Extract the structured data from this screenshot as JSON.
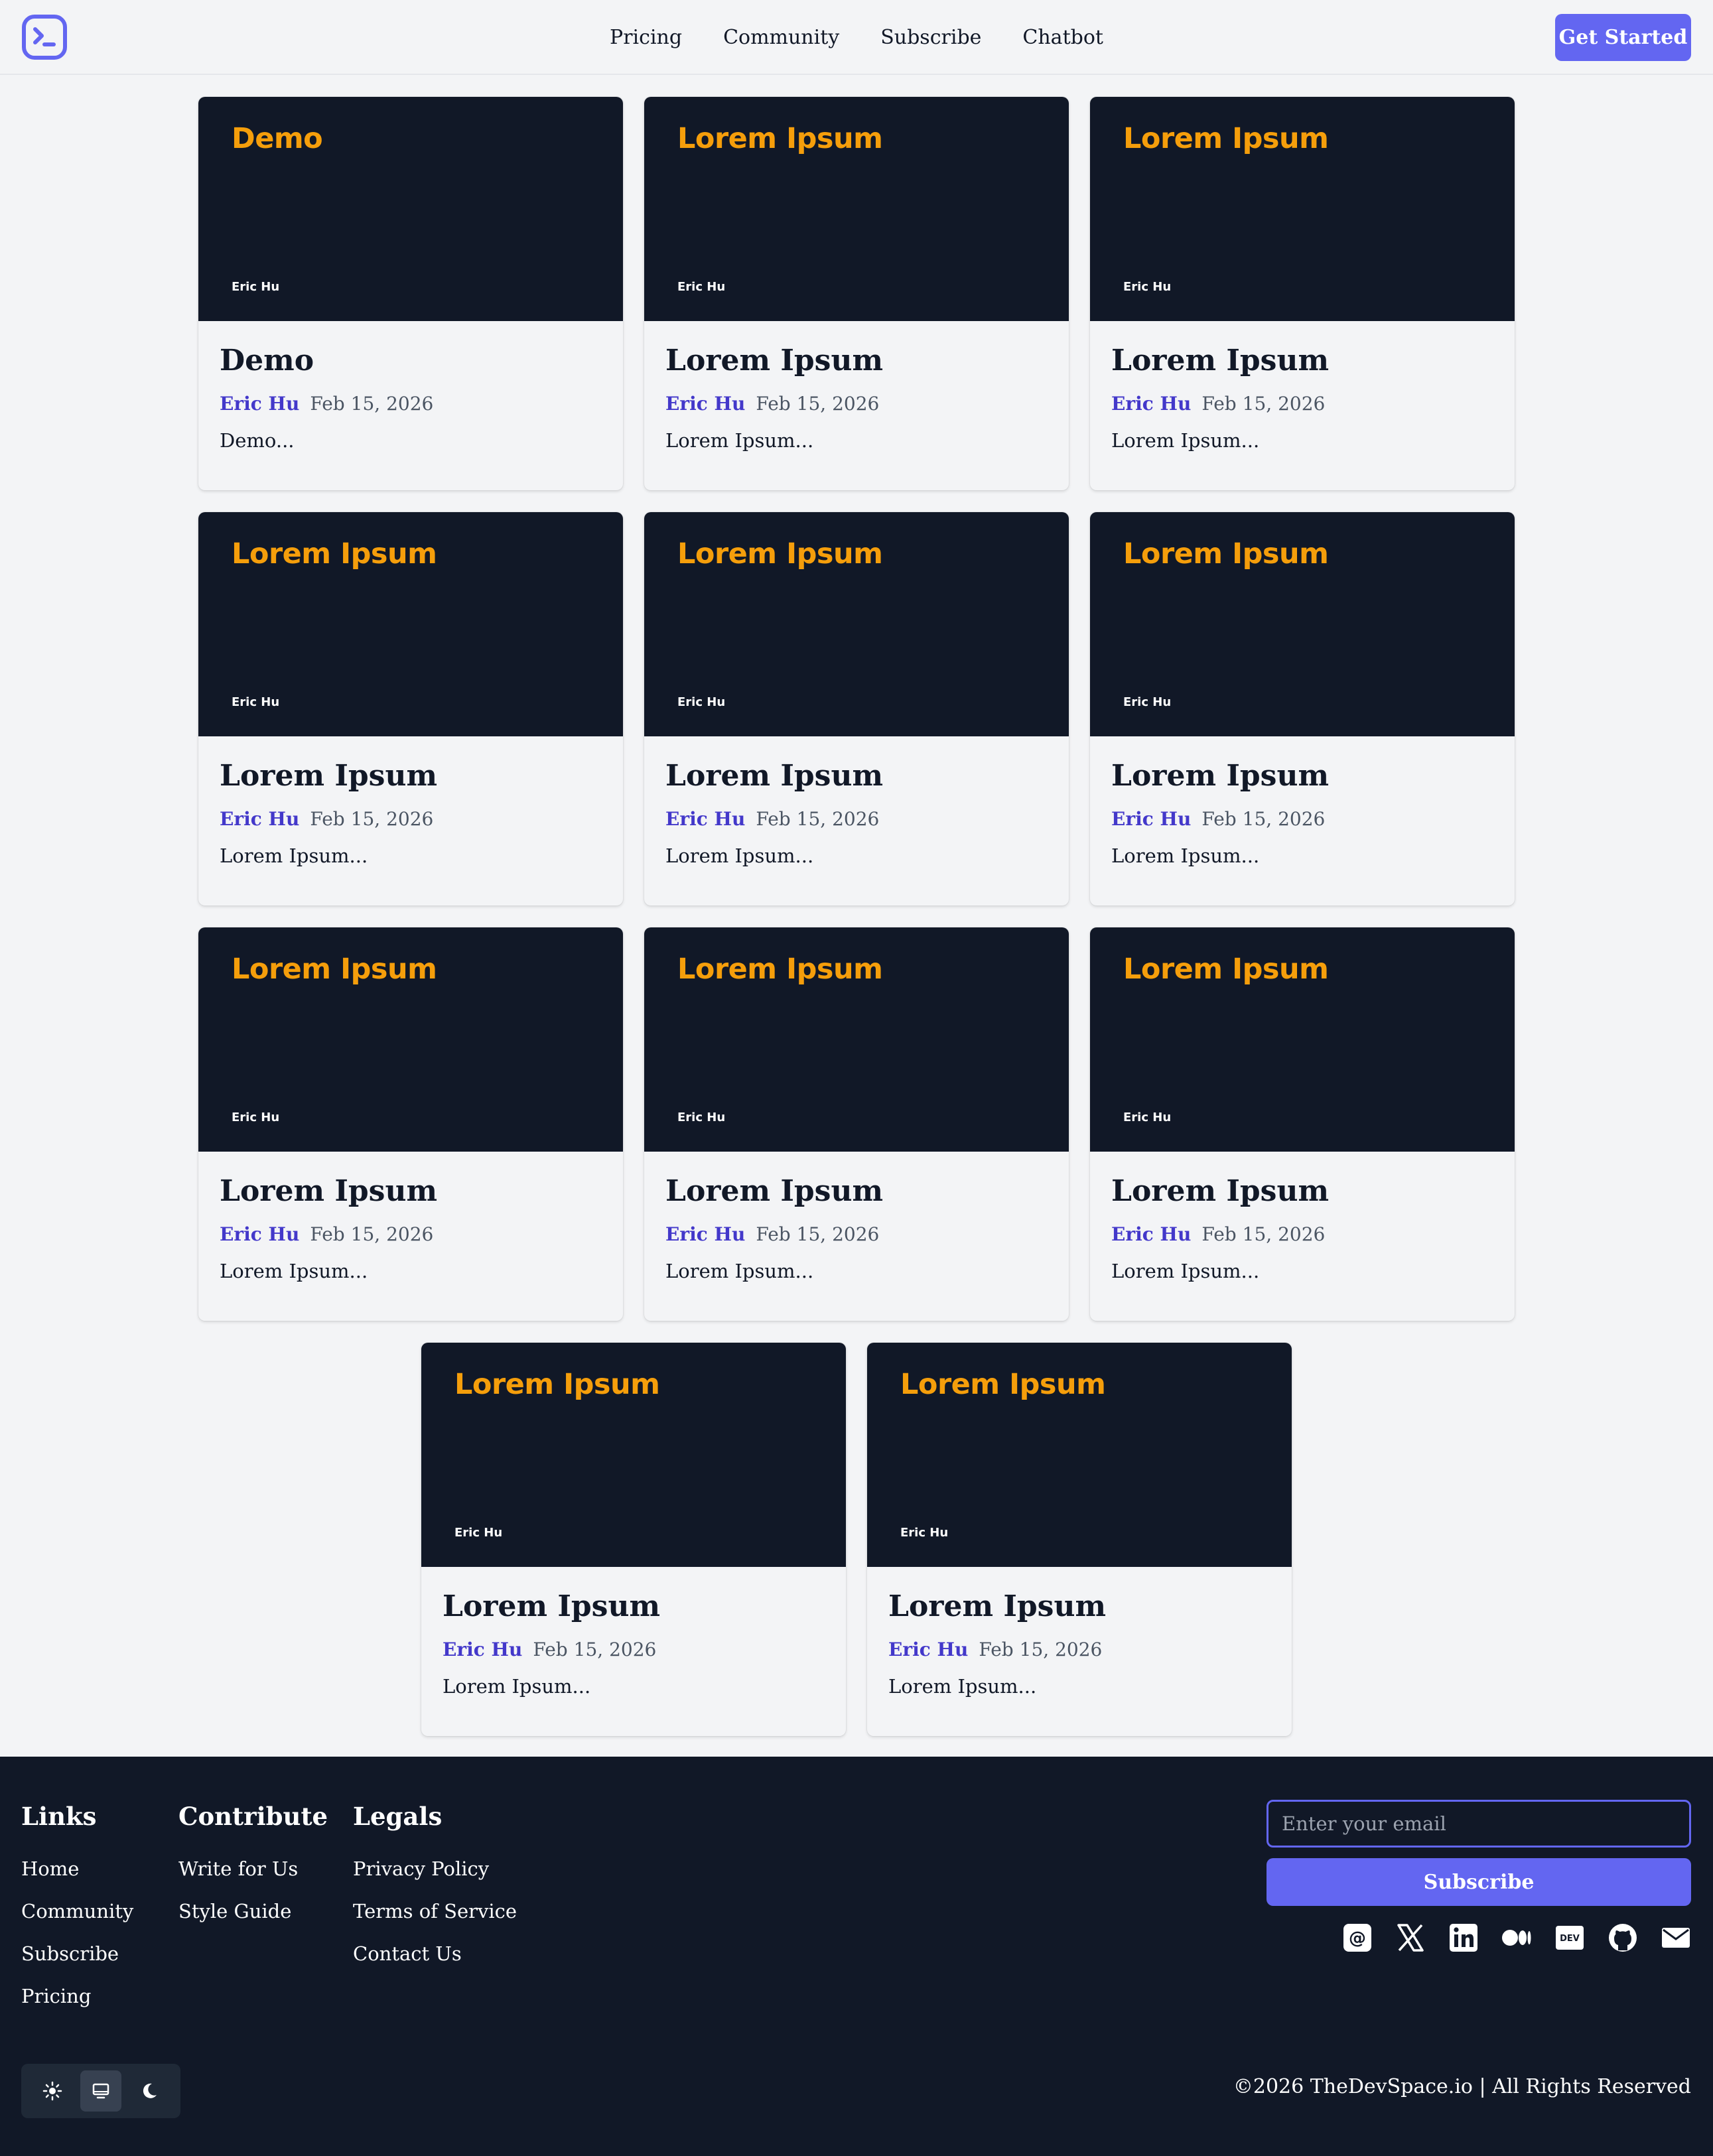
{
  "header": {
    "logo_icon": "terminal-icon",
    "nav": [
      "Pricing",
      "Community",
      "Subscribe",
      "Chatbot"
    ],
    "cta": "Get Started"
  },
  "cards": [
    {
      "thumb_title": "Demo",
      "thumb_author": "Eric Hu",
      "title": "Demo",
      "author": "Eric Hu",
      "date": "Feb 15, 2026",
      "excerpt": "Demo..."
    },
    {
      "thumb_title": "Lorem Ipsum",
      "thumb_author": "Eric Hu",
      "title": "Lorem Ipsum",
      "author": "Eric Hu",
      "date": "Feb 15, 2026",
      "excerpt": "Lorem Ipsum..."
    },
    {
      "thumb_title": "Lorem Ipsum",
      "thumb_author": "Eric Hu",
      "title": "Lorem Ipsum",
      "author": "Eric Hu",
      "date": "Feb 15, 2026",
      "excerpt": "Lorem Ipsum..."
    },
    {
      "thumb_title": "Lorem Ipsum",
      "thumb_author": "Eric Hu",
      "title": "Lorem Ipsum",
      "author": "Eric Hu",
      "date": "Feb 15, 2026",
      "excerpt": "Lorem Ipsum..."
    },
    {
      "thumb_title": "Lorem Ipsum",
      "thumb_author": "Eric Hu",
      "title": "Lorem Ipsum",
      "author": "Eric Hu",
      "date": "Feb 15, 2026",
      "excerpt": "Lorem Ipsum..."
    },
    {
      "thumb_title": "Lorem Ipsum",
      "thumb_author": "Eric Hu",
      "title": "Lorem Ipsum",
      "author": "Eric Hu",
      "date": "Feb 15, 2026",
      "excerpt": "Lorem Ipsum..."
    },
    {
      "thumb_title": "Lorem Ipsum",
      "thumb_author": "Eric Hu",
      "title": "Lorem Ipsum",
      "author": "Eric Hu",
      "date": "Feb 15, 2026",
      "excerpt": "Lorem Ipsum..."
    },
    {
      "thumb_title": "Lorem Ipsum",
      "thumb_author": "Eric Hu",
      "title": "Lorem Ipsum",
      "author": "Eric Hu",
      "date": "Feb 15, 2026",
      "excerpt": "Lorem Ipsum..."
    },
    {
      "thumb_title": "Lorem Ipsum",
      "thumb_author": "Eric Hu",
      "title": "Lorem Ipsum",
      "author": "Eric Hu",
      "date": "Feb 15, 2026",
      "excerpt": "Lorem Ipsum..."
    },
    {
      "thumb_title": "Lorem Ipsum",
      "thumb_author": "Eric Hu",
      "title": "Lorem Ipsum",
      "author": "Eric Hu",
      "date": "Feb 15, 2026",
      "excerpt": "Lorem Ipsum..."
    },
    {
      "thumb_title": "Lorem Ipsum",
      "thumb_author": "Eric Hu",
      "title": "Lorem Ipsum",
      "author": "Eric Hu",
      "date": "Feb 15, 2026",
      "excerpt": "Lorem Ipsum..."
    }
  ],
  "footer": {
    "links": {
      "heading": "Links",
      "items": [
        "Home",
        "Community",
        "Subscribe",
        "Pricing"
      ]
    },
    "contribute": {
      "heading": "Contribute",
      "items": [
        "Write for Us",
        "Style Guide"
      ]
    },
    "legals": {
      "heading": "Legals",
      "items": [
        "Privacy Policy",
        "Terms of Service",
        "Contact Us"
      ]
    },
    "email_placeholder": "Enter your email",
    "subscribe_label": "Subscribe",
    "socials": [
      "threads-icon",
      "x-icon",
      "linkedin-icon",
      "medium-icon",
      "dev-icon",
      "github-icon",
      "mail-icon"
    ],
    "theme_options": [
      "sun-icon",
      "monitor-icon",
      "moon-icon"
    ],
    "theme_selected": "monitor-icon",
    "copyright": "©2026 TheDevSpace.io | All Rights Reserved"
  },
  "colors": {
    "accent": "#6366f1",
    "thumb_bg": "#111827",
    "thumb_title": "#f59e0b",
    "author_link": "#4338ca",
    "footer_bg": "#111827"
  }
}
